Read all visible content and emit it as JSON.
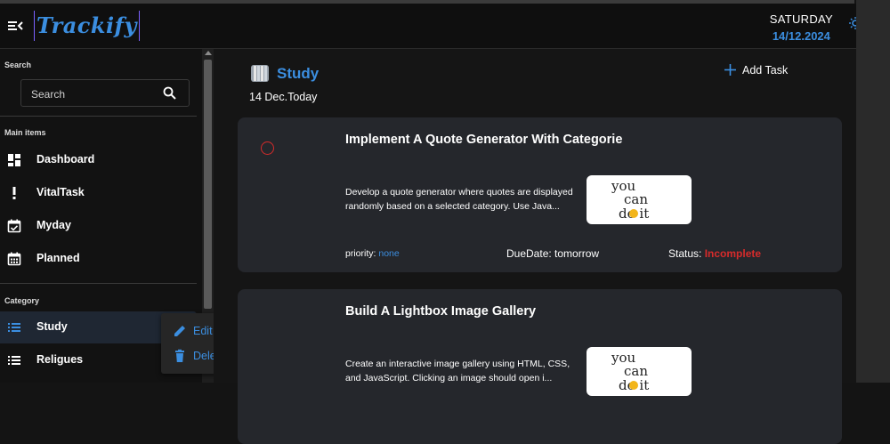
{
  "app": {
    "title": "Trackify"
  },
  "header": {
    "day": "SATURDAY",
    "date": "14/12.2024"
  },
  "sidebar": {
    "search_label": "Search",
    "search_placeholder": "Search",
    "main_items_label": "Main items",
    "main_items": [
      {
        "label": "Dashboard",
        "icon": "dashboard-icon"
      },
      {
        "label": "VitalTask",
        "icon": "exclamation-icon"
      },
      {
        "label": "Myday",
        "icon": "calendar-check-icon"
      },
      {
        "label": "Planned",
        "icon": "calendar-grid-icon"
      }
    ],
    "category_label": "Category",
    "categories": [
      {
        "label": "Study",
        "icon": "list-icon",
        "active": true
      },
      {
        "label": "Religues",
        "icon": "list-icon",
        "active": false
      }
    ]
  },
  "context_menu": {
    "edit_label": "Edit",
    "delete_label": "Delete"
  },
  "main": {
    "category_title": "Study",
    "date_label": "14 Dec.Today",
    "add_task_label": "Add Task",
    "tasks": [
      {
        "title": "Implement A Quote Generator With Categorie",
        "description": "Develop a quote generator where quotes are displayed randomly based on a selected category. Use Java...",
        "priority_label": "priority:",
        "priority_value": "none",
        "due_label": "DueDate: tomorrow",
        "status_label": "Status:",
        "status_value": "Incomplete",
        "image_text_1": "you",
        "image_text_2": "can",
        "image_text_3": "do it"
      },
      {
        "title": "Build A Lightbox Image Gallery",
        "description": "Create an interactive image gallery using HTML, CSS, and JavaScript. Clicking an image should open i...",
        "image_text_1": "you",
        "image_text_2": "can",
        "image_text_3": "do it"
      }
    ]
  },
  "colors": {
    "accent": "#3b8ee0",
    "danger": "#d62b2b",
    "card": "#25272c",
    "background": "#141414"
  }
}
